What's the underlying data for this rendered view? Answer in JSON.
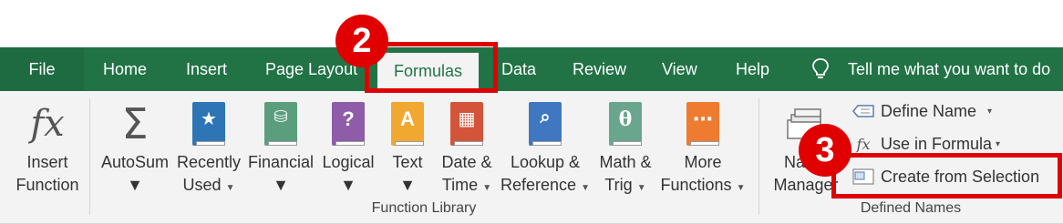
{
  "tabs": {
    "file": "File",
    "home": "Home",
    "insert": "Insert",
    "page_layout": "Page Layout",
    "formulas": "Formulas",
    "data": "Data",
    "review": "Review",
    "view": "View",
    "help": "Help"
  },
  "tell_me": "Tell me what you want to do",
  "commands": {
    "insert_function": [
      "Insert",
      "Function"
    ],
    "autosum": "AutoSum",
    "recently_used": [
      "Recently",
      "Used"
    ],
    "financial": "Financial",
    "logical": "Logical",
    "text": "Text",
    "date_time": [
      "Date &",
      "Time"
    ],
    "lookup_reference": [
      "Lookup &",
      "Reference"
    ],
    "math_trig": [
      "Math &",
      "Trig"
    ],
    "more_functions": [
      "More",
      "Functions"
    ],
    "name_manager": [
      "Name",
      "Manager"
    ]
  },
  "groups": {
    "function_library": "Function Library",
    "defined_names": "Defined Names"
  },
  "defined_names": {
    "define_name": "Define Name",
    "use_in_formula": "Use in Formula",
    "create_from_selection": "Create from Selection"
  },
  "annotations": {
    "step2": "2",
    "step3": "3",
    "accent": "#e00000"
  },
  "colors": {
    "excel_green": "#217346",
    "ribbon_bg": "#f3f3f3"
  }
}
